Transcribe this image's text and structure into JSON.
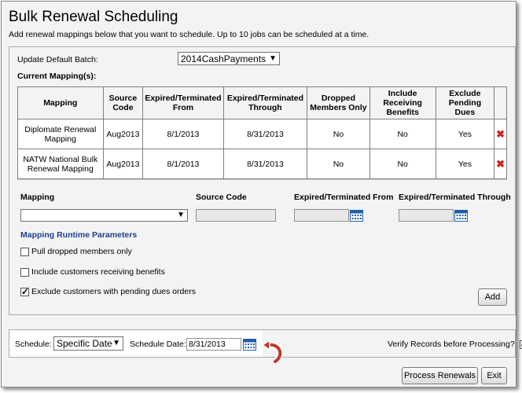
{
  "header": {
    "title": "Bulk Renewal Scheduling",
    "subtitle": "Add renewal mappings below that you want to schedule. Up to 10 jobs can be scheduled at a time."
  },
  "batch": {
    "label": "Update Default Batch:",
    "selected": "2014CashPayments"
  },
  "current_mappings": {
    "label": "Current Mapping(s):",
    "columns": [
      "Mapping",
      "Source Code",
      "Expired/Terminated From",
      "Expired/Terminated Through",
      "Dropped Members Only",
      "Include Receiving Benefits",
      "Exclude Pending Dues"
    ],
    "rows": [
      [
        "Diplomate Renewal Mapping",
        "Aug2013",
        "8/1/2013",
        "8/31/2013",
        "No",
        "No",
        "Yes"
      ],
      [
        "NATW National Bulk Renewal Mapping",
        "Aug2013",
        "8/1/2013",
        "8/31/2013",
        "No",
        "No",
        "Yes"
      ]
    ]
  },
  "add_form": {
    "mapping_label": "Mapping",
    "source_code_label": "Source Code",
    "from_label": "Expired/Terminated From",
    "through_label": "Expired/Terminated Through",
    "mapping_value": "",
    "source_code_value": "",
    "from_value": "",
    "through_value": "",
    "runtime_params_label": "Mapping Runtime Parameters",
    "opt_pull_dropped": "Pull dropped members only",
    "opt_include_benefits": "Include customers receiving benefits",
    "opt_exclude_pending": "Exclude customers with pending dues orders",
    "opt_pull_dropped_checked": false,
    "opt_include_benefits_checked": false,
    "opt_exclude_pending_checked": true,
    "add_label": "Add"
  },
  "schedule": {
    "label": "Schedule:",
    "selected": "Specific Date",
    "date_label": "Schedule Date:",
    "date_value": "8/31/2013",
    "verify_label": "Verify Records before Processing?",
    "verify_checked": true
  },
  "footer": {
    "process_label": "Process Renewals",
    "exit_label": "Exit"
  },
  "colors": {
    "link": "#1e3f8a",
    "delete": "#d21e1e",
    "calendar": "#1f5fa8",
    "arrow": "#c0392b"
  }
}
